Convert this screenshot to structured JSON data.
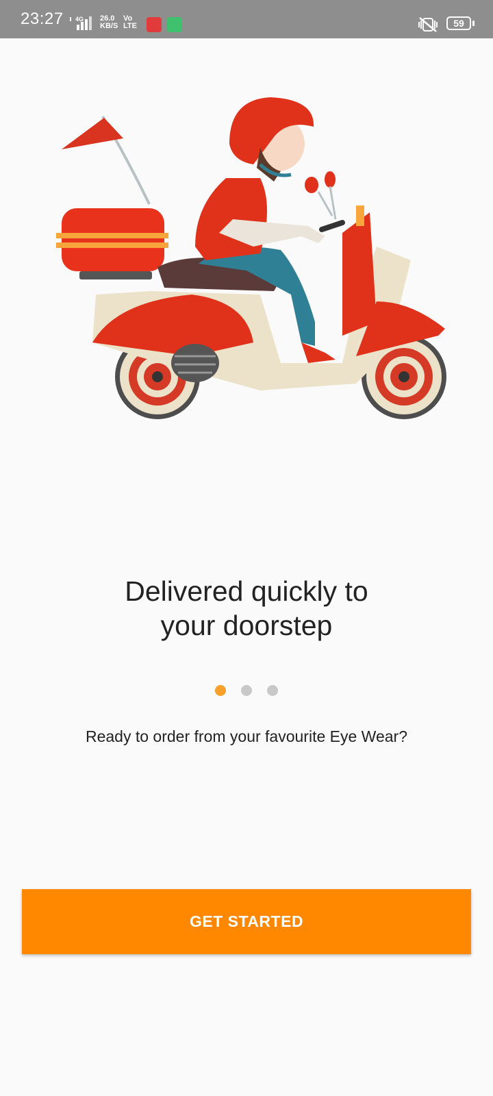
{
  "status_bar": {
    "time": "23:27",
    "network_label": "4G",
    "data_speed_top": "26.0",
    "data_speed_bottom": "KB/S",
    "volte_top": "Vo",
    "volte_bottom": "LTE",
    "battery": "59"
  },
  "onboarding": {
    "title_line1": "Delivered quickly to",
    "title_line2": "your doorstep",
    "subtitle": "Ready to order from your favourite Eye Wear?",
    "page_indicator": {
      "count": 3,
      "active_index": 0
    }
  },
  "cta": {
    "label": "GET STARTED"
  },
  "colors": {
    "accent": "#ff8800",
    "dot_active": "#f7a02c",
    "dot_inactive": "#c8c8c8"
  }
}
